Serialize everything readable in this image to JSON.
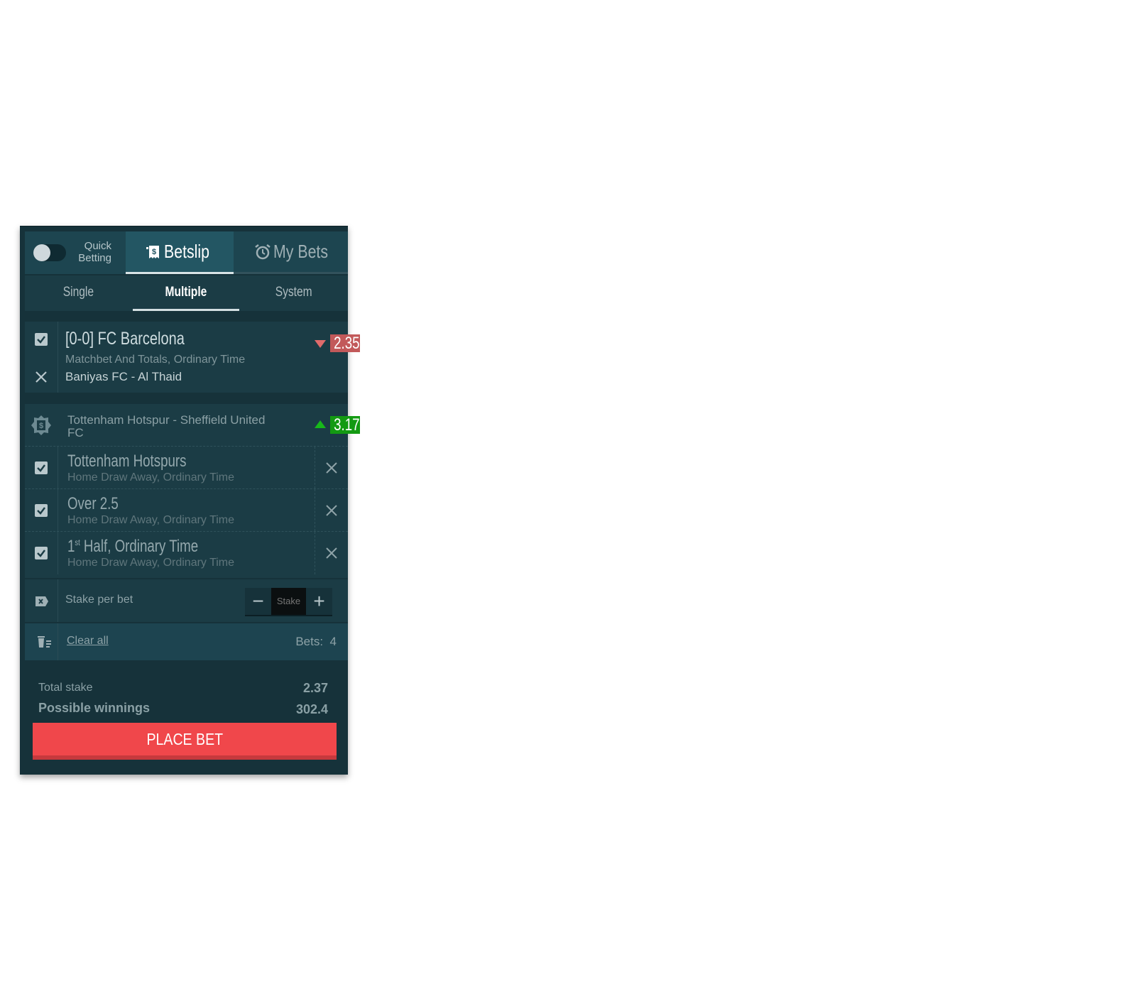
{
  "header": {
    "quick_betting_line1": "Quick",
    "quick_betting_line2": "Betting",
    "tab_betslip": "Betslip",
    "tab_my_bets": "My Bets"
  },
  "subtabs": [
    {
      "label": "Single"
    },
    {
      "label": "Multiple",
      "active": true
    },
    {
      "label": "System"
    }
  ],
  "single_selection": {
    "title": "[0-0] FC Barcelona",
    "market": "Matchbet And Totals, Ordinary Time",
    "event": "Baniyas FC - Al Thaid",
    "odds": "2.35",
    "odds_trend": "down"
  },
  "group": {
    "title": "Tottenham Hotspur - Sheffield United FC",
    "odds": "3.17",
    "odds_trend": "up",
    "legs": [
      {
        "title": "Tottenham Hotspurs",
        "title_sup": "",
        "market": "Home Draw Away, Ordinary Time"
      },
      {
        "title": "Over 2.5",
        "title_sup": "",
        "market": "Home Draw Away, Ordinary Time"
      },
      {
        "title_prefix": "1",
        "title_sup": "st",
        "title": "Half, Ordinary Time",
        "market": "Home Draw Away, Ordinary Time"
      }
    ]
  },
  "stake": {
    "label": "Stake per bet",
    "placeholder": "Stake",
    "minus": "−",
    "plus": "+"
  },
  "clear": {
    "label": "Clear all",
    "bets_label": "Bets:",
    "bets_count": "4"
  },
  "totals": {
    "total_stake_label": "Total stake",
    "total_stake_value": "2.37",
    "possible_winnings_label": "Possible winnings",
    "possible_winnings_value": "302.4"
  },
  "place_bet_label": "PLACE BET",
  "colors": {
    "panel_bg": "#16323a",
    "odds_down": "#c2595a",
    "odds_up": "#139a12",
    "place_bet": "#f0474b"
  }
}
